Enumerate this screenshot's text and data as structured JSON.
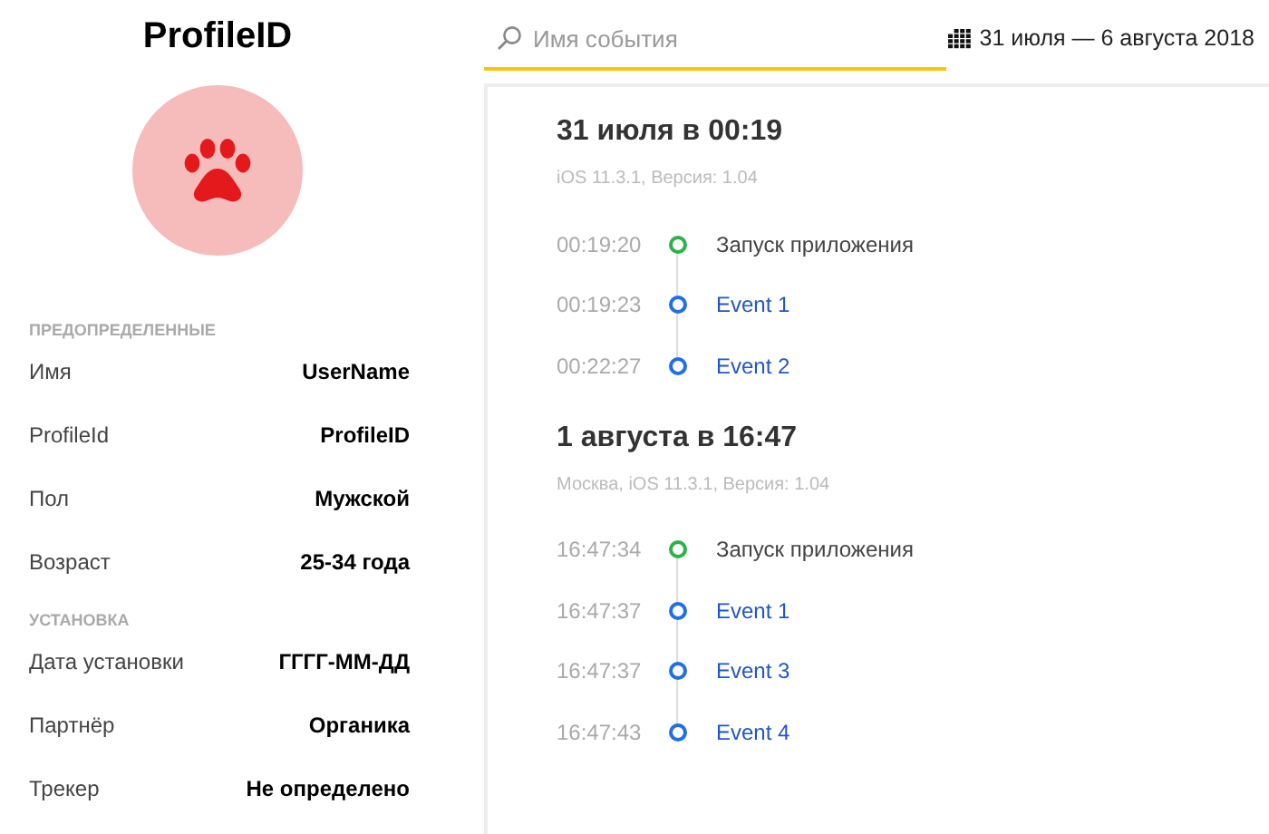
{
  "profile": {
    "title": "ProfileID"
  },
  "sections": [
    {
      "heading": "ПРЕДОПРЕДЕЛЕННЫЕ",
      "rows": [
        {
          "label": "Имя",
          "value": "UserName"
        },
        {
          "label": "ProfileId",
          "value": "ProfileID"
        },
        {
          "label": "Пол",
          "value": "Мужской"
        },
        {
          "label": "Возраст",
          "value": "25-34 года"
        }
      ]
    },
    {
      "heading": "УСТАНОВКА",
      "rows": [
        {
          "label": "Дата установки",
          "value": "ГГГГ-ММ-ДД"
        },
        {
          "label": "Партнёр",
          "value": "Органика"
        },
        {
          "label": "Трекер",
          "value": "Не определено"
        }
      ]
    }
  ],
  "search": {
    "placeholder": "Имя события"
  },
  "date_range": "31 июля — 6 августа 2018",
  "sessions": [
    {
      "title": "31 июля в 00:19",
      "subtitle": "iOS 11.3.1, Версия: 1.04",
      "events": [
        {
          "time": "00:19:20",
          "name": "Запуск приложения",
          "kind": "launch"
        },
        {
          "time": "00:19:23",
          "name": "Event 1",
          "kind": "event"
        },
        {
          "time": "00:22:27",
          "name": "Event 2",
          "kind": "event"
        }
      ]
    },
    {
      "title": "1 августа в 16:47",
      "subtitle": "Москва, iOS 11.3.1, Версия: 1.04",
      "events": [
        {
          "time": "16:47:34",
          "name": "Запуск приложения",
          "kind": "launch"
        },
        {
          "time": "16:47:37",
          "name": "Event 1",
          "kind": "event"
        },
        {
          "time": "16:47:37",
          "name": "Event 3",
          "kind": "event"
        },
        {
          "time": "16:47:43",
          "name": "Event 4",
          "kind": "event"
        }
      ]
    }
  ]
}
